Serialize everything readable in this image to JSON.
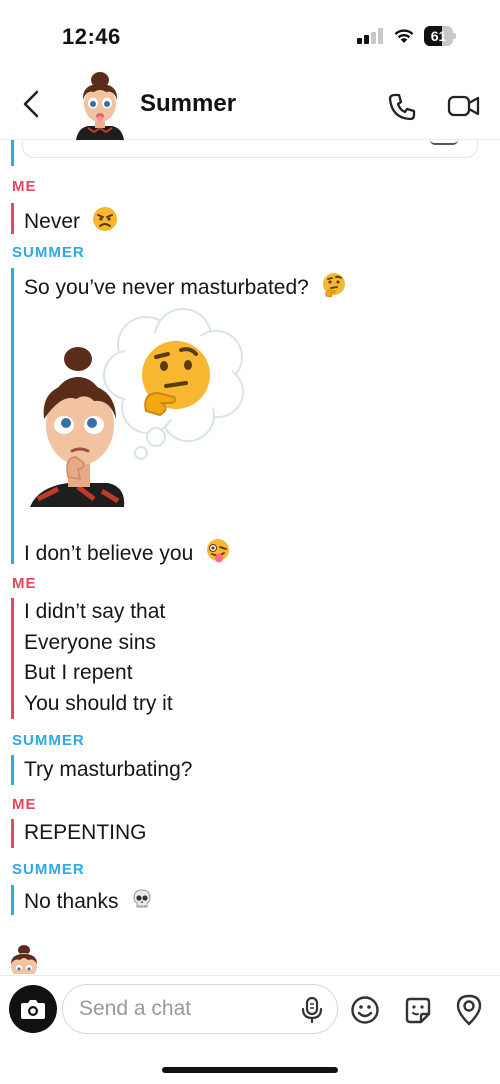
{
  "status_bar": {
    "time": "12:46",
    "battery": "61",
    "battery_level": 0.61,
    "icons": [
      "signal-icon",
      "wifi-icon",
      "battery-icon"
    ]
  },
  "header": {
    "title": "Summer",
    "icons": [
      "back-chevron-icon",
      "avatar",
      "phone-icon",
      "video-camera-icon"
    ]
  },
  "messages": [
    {
      "sender": "ME",
      "lines": [
        "Never"
      ],
      "emoji": "angry-face-emoji"
    },
    {
      "sender": "SUMMER",
      "lines": [
        "So you’ve never masturbated?"
      ],
      "emoji": "thinking-face-emoji"
    },
    {
      "sender": "SUMMER",
      "sticker": "thinking-bitmoji-sticker",
      "lines": [
        "I don’t believe you"
      ],
      "emoji": "zany-face-emoji"
    },
    {
      "sender": "ME",
      "lines": [
        "I didn’t say that",
        "Everyone sins",
        "But I repent",
        "You should try it"
      ]
    },
    {
      "sender": "SUMMER",
      "lines": [
        "Try masturbating?"
      ]
    },
    {
      "sender": "ME",
      "lines": [
        "REPENTING"
      ]
    },
    {
      "sender": "SUMMER",
      "lines": [
        "No thanks"
      ],
      "emoji": "skull-emoji"
    }
  ],
  "composer": {
    "placeholder": "Send a chat",
    "icons": [
      "camera-icon",
      "microphone-icon",
      "emoji-icon",
      "sticker-icon",
      "map-pin-icon"
    ]
  },
  "colors": {
    "me": "#e8475c",
    "summer": "#2ea8e8",
    "text": "#161616"
  }
}
